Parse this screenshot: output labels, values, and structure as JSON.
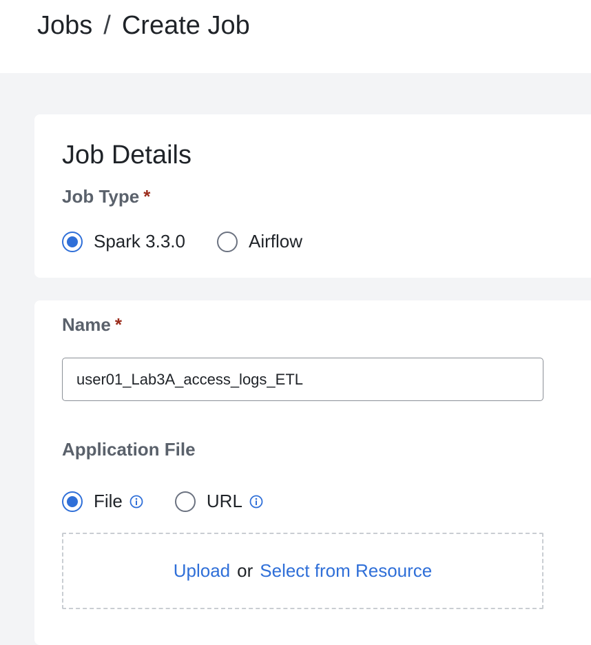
{
  "breadcrumb": {
    "root": "Jobs",
    "separator": "/",
    "current": "Create Job"
  },
  "job_details": {
    "title": "Job Details",
    "job_type_label": "Job Type",
    "required_marker": "*",
    "job_type_options": [
      "Spark 3.3.0",
      "Airflow"
    ],
    "job_type_selected": "Spark 3.3.0"
  },
  "name": {
    "label": "Name",
    "required_marker": "*",
    "value": "user01_Lab3A_access_logs_ETL"
  },
  "application_file": {
    "label": "Application File",
    "options": [
      "File",
      "URL"
    ],
    "selected": "File",
    "upload_link": "Upload",
    "or_text": "or",
    "select_resource_link": "Select from Resource"
  },
  "colors": {
    "accent": "#2f6fd8",
    "required": "#9b2c1c",
    "background": "#f3f4f6"
  },
  "icons": {
    "info": "info-circle-icon"
  }
}
